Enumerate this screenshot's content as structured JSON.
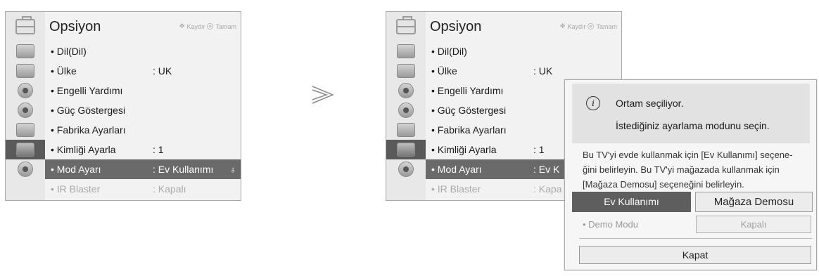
{
  "menu": {
    "title": "Opsiyon",
    "hint_move": "Kaydır",
    "hint_ok": "Tamam",
    "items": [
      {
        "label": "Dil(Dil)",
        "value": ""
      },
      {
        "label": "Ülke",
        "value": ": UK"
      },
      {
        "label": "Engelli Yardımı",
        "value": ""
      },
      {
        "label": "Güç Göstergesi",
        "value": ""
      },
      {
        "label": "Fabrika Ayarları",
        "value": ""
      },
      {
        "label": "Kimliği Ayarla",
        "value": ": 1"
      },
      {
        "label": "Mod Ayarı",
        "value": ": Ev Kullanımı",
        "selected": true
      },
      {
        "label": "IR Blaster",
        "value": ": Kapalı",
        "disabled": true
      }
    ],
    "right_values": {
      "mod": ": Ev K",
      "ir": ": Kapa"
    },
    "side_icons": [
      "picture-icon",
      "screen-icon",
      "audio-icon",
      "time-icon",
      "lock-icon",
      "option-icon",
      "network-icon"
    ]
  },
  "popup": {
    "info_line1": "Ortam seçiliyor.",
    "info_line2": "İstediğiniz ayarlama modunu seçin.",
    "description": "Bu TV'yi evde kullanmak için [Ev Kullanımı] seçene-ğini belirleyin. Bu TV'yi mağazada kullanmak için [Mağaza Demosu] seçeneğini belirleyin.",
    "desc_line1": "Bu TV'yi evde kullanmak için [Ev Kullanımı] seçene-",
    "desc_line2": "ğini belirleyin. Bu TV'yi mağazada kullanmak için",
    "desc_line3": "[Mağaza Demosu] seçeneğini belirleyin.",
    "option_home": "Ev Kullanımı",
    "option_store": "Mağaza Demosu",
    "demo_label": "Demo Modu",
    "demo_value": "Kapalı",
    "close": "Kapat"
  },
  "colors": {
    "selected_bg": "#6a6a6a",
    "panel_bg": "#f2f2f2",
    "disabled_text": "#aaaaaa"
  }
}
